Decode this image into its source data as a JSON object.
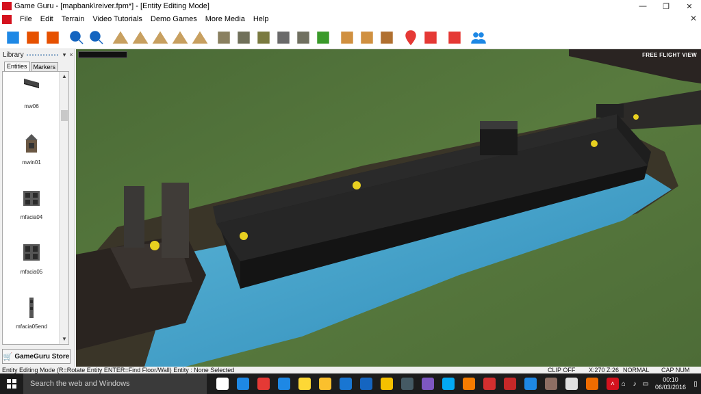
{
  "window": {
    "title": "Game Guru - [mapbank\\reiver.fpm*] - [Entity Editing Mode]",
    "logo_text": "Game Guru",
    "minimize": "—",
    "restore": "❐",
    "close": "✕"
  },
  "menu": {
    "items": [
      "File",
      "Edit",
      "Terrain",
      "Video Tutorials",
      "Demo Games",
      "More Media",
      "Help"
    ],
    "close_glyph": "✕"
  },
  "toolbar": {
    "buttons": [
      {
        "name": "new-level-icon",
        "color": "#1e88e5"
      },
      {
        "name": "load-level-icon",
        "color": "#e65100"
      },
      {
        "name": "save-level-icon",
        "color": "#e65100"
      },
      {
        "name": "zoom-in-icon",
        "color": "#1565c0"
      },
      {
        "name": "zoom-out-icon",
        "color": "#1565c0"
      },
      {
        "name": "raise-terrain-icon",
        "color": "#c8a060"
      },
      {
        "name": "lower-terrain-icon",
        "color": "#c8a060"
      },
      {
        "name": "level-terrain-icon",
        "color": "#c8a060"
      },
      {
        "name": "blend-terrain-icon",
        "color": "#c8a060"
      },
      {
        "name": "ramp-terrain-icon",
        "color": "#c8a060"
      },
      {
        "name": "paint-texture-1-icon",
        "color": "#8a8060"
      },
      {
        "name": "paint-texture-2-icon",
        "color": "#70705a"
      },
      {
        "name": "paint-texture-3-icon",
        "color": "#7a7a40"
      },
      {
        "name": "paint-texture-4-icon",
        "color": "#6a6a6a"
      },
      {
        "name": "paint-texture-5-icon",
        "color": "#707060"
      },
      {
        "name": "paint-grass-icon",
        "color": "#3a9a2a"
      },
      {
        "name": "add-entity-icon",
        "color": "#d09040"
      },
      {
        "name": "add-building-icon",
        "color": "#d09040"
      },
      {
        "name": "add-terrain-object-icon",
        "color": "#b07030"
      },
      {
        "name": "add-marker-icon",
        "color": "#e53935"
      },
      {
        "name": "waypoint-icon",
        "color": "#e53935"
      },
      {
        "name": "test-game-icon",
        "color": "#e53935"
      },
      {
        "name": "multiplayer-icon",
        "color": "#1e88e5"
      }
    ]
  },
  "library": {
    "title": "Library",
    "tabs": [
      "Entities",
      "Markers"
    ],
    "entries": [
      {
        "label": "mw06"
      },
      {
        "label": "mwin01"
      },
      {
        "label": "mfacia04"
      },
      {
        "label": "mfacia05"
      },
      {
        "label": "mfacia05end"
      },
      {
        "label": ""
      }
    ],
    "store_label": "GameGuru Store"
  },
  "viewport": {
    "mode_label": "FREE FLIGHT VIEW",
    "colors": {
      "grass": "#53703c",
      "water": "#3a9fc8",
      "structure": "#1c1c1c",
      "light": "#e8d020"
    }
  },
  "status": {
    "mode_text": "Entity Editing Mode (R=Rotate Entity  ENTER=Find Floor/Wall)  Entity : None Selected",
    "clip": "CLIP OFF",
    "coords": "X:270  Z:26",
    "render": "NORMAL",
    "keys": "CAP NUM SCRL"
  },
  "taskbar": {
    "search_placeholder": "Search the web and Windows",
    "time": "00:10",
    "date": "06/03/2016",
    "apps": [
      {
        "name": "task-view-icon",
        "color": "#ffffff"
      },
      {
        "name": "store-app-icon",
        "color": "#1e88e5"
      },
      {
        "name": "chrome-icon",
        "color": "#e53935"
      },
      {
        "name": "ie-icon",
        "color": "#1e88e5"
      },
      {
        "name": "mail-icon",
        "color": "#fdd835"
      },
      {
        "name": "explorer-icon",
        "color": "#fbc02d"
      },
      {
        "name": "edge-icon",
        "color": "#1976d2"
      },
      {
        "name": "outlook-icon",
        "color": "#1565c0"
      },
      {
        "name": "app-icon",
        "color": "#f5c000"
      },
      {
        "name": "steam-icon",
        "color": "#455a64"
      },
      {
        "name": "app2-icon",
        "color": "#7e57c2"
      },
      {
        "name": "app3-icon",
        "color": "#03a9f4"
      },
      {
        "name": "paint-icon",
        "color": "#f57c00"
      },
      {
        "name": "acrobat-icon",
        "color": "#d32f2f"
      },
      {
        "name": "app4-icon",
        "color": "#c62828"
      },
      {
        "name": "app5-icon",
        "color": "#1e88e5"
      },
      {
        "name": "app6-icon",
        "color": "#8d6e63"
      },
      {
        "name": "calculator-icon",
        "color": "#e0e0e0"
      },
      {
        "name": "blender-icon",
        "color": "#ef6c00"
      },
      {
        "name": "gameguru-task-icon",
        "color": "#d4121e"
      }
    ]
  }
}
